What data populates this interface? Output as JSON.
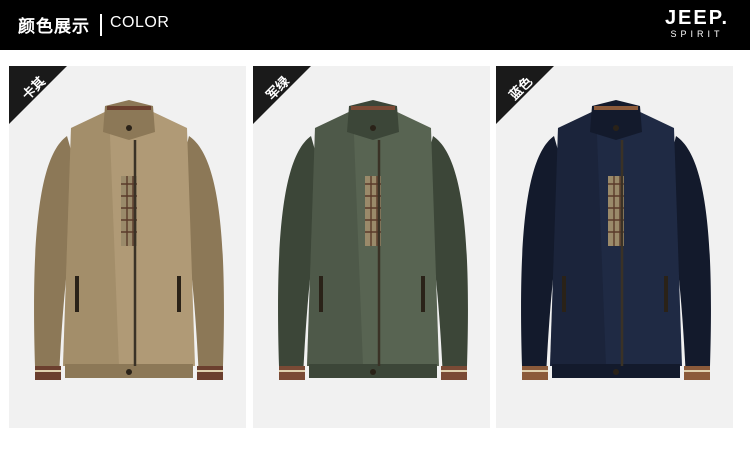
{
  "header": {
    "title": "颜色展示",
    "subtitle": "COLOR",
    "brand_main": "JEEP.",
    "brand_sub": "SPIRIT"
  },
  "variants": [
    {
      "label": "卡其",
      "color": "#b09a76",
      "shade": "#8c7857",
      "trim": "#6b3f2e"
    },
    {
      "label": "军绿",
      "color": "#586452",
      "shade": "#3c4638",
      "trim": "#7a4a35"
    },
    {
      "label": "蓝色",
      "color": "#1f2a44",
      "shade": "#131a2c",
      "trim": "#8b5a3a"
    }
  ]
}
